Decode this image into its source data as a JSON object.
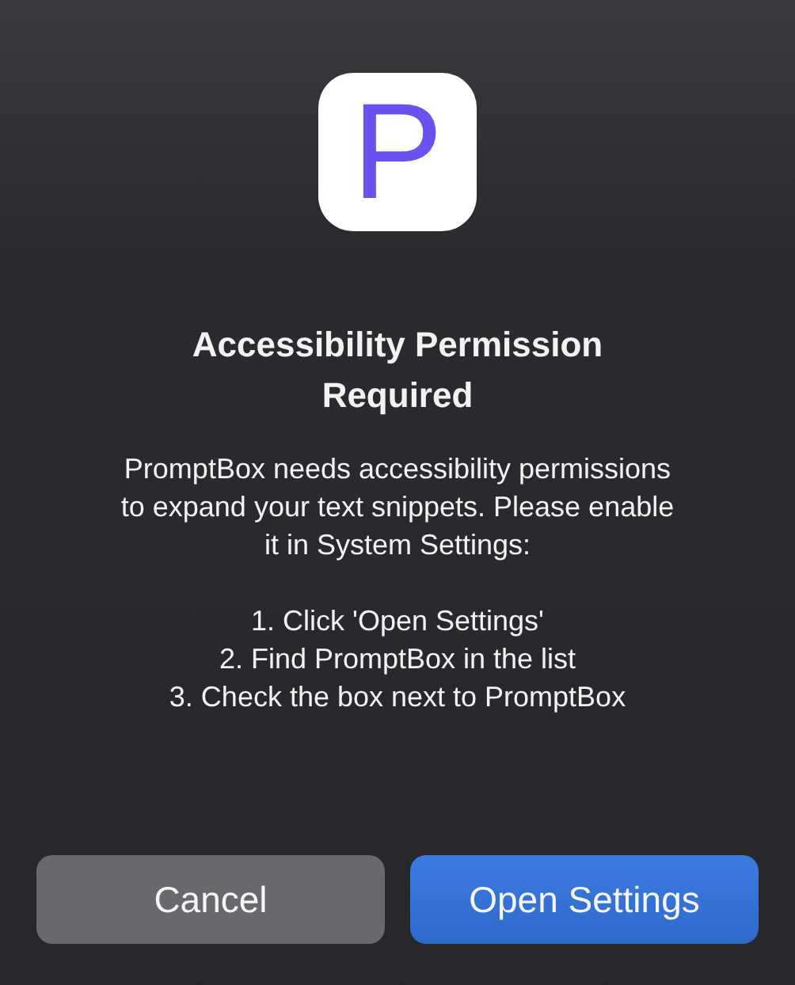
{
  "app_icon": {
    "letter": "P"
  },
  "title": "Accessibility Permission Required",
  "message": "PromptBox needs accessibility permissions to expand your text snippets. Please enable it in System Settings:",
  "steps": [
    "1. Click 'Open Settings'",
    "2. Find PromptBox in the list",
    "3. Check the box next to PromptBox"
  ],
  "buttons": [
    {
      "label": "Cancel",
      "kind": "secondary"
    },
    {
      "label": "Open Settings",
      "kind": "primary"
    }
  ]
}
